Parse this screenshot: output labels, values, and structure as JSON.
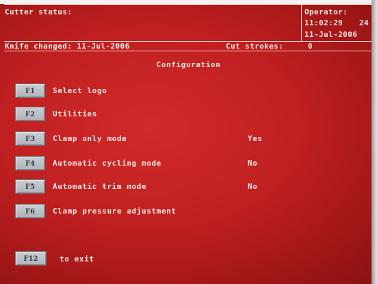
{
  "header": {
    "cutter_status_label": "Cutter status:",
    "operator_label": "Operator:",
    "time": "11:02:29",
    "time_suffix": "24",
    "date": "11-Jul-2006",
    "knife_changed": "Knife changed: 11-Jul-2006",
    "cut_strokes_label": "Cut strokes:",
    "cut_strokes_value": "0"
  },
  "title": "Configuration",
  "menu": [
    {
      "key": "F1",
      "label": "Select logo",
      "value": ""
    },
    {
      "key": "F2",
      "label": "Utilities",
      "value": ""
    },
    {
      "key": "F3",
      "label": "Clamp only mode",
      "value": "Yes"
    },
    {
      "key": "F4",
      "label": "Automatic cycling mode",
      "value": "No"
    },
    {
      "key": "F5",
      "label": "Automatic trim mode",
      "value": "No"
    },
    {
      "key": "F6",
      "label": "Clamp pressure adjustment",
      "value": ""
    }
  ],
  "exit": {
    "key": "F12",
    "label": "to exit"
  },
  "colors": {
    "screen_red": "#c12020",
    "key_gray": "#b4bac0",
    "text": "#ffe8e4"
  }
}
